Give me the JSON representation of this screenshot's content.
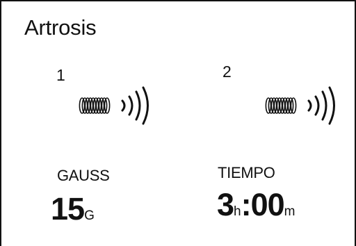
{
  "screen": {
    "title": "Artrosis"
  },
  "channels": [
    {
      "number": "1",
      "icon": "magnetic-coil-icon"
    },
    {
      "number": "2",
      "icon": "magnetic-coil-icon"
    }
  ],
  "gauss": {
    "label": "GAUSS",
    "value": "15",
    "unit": "G"
  },
  "tiempo": {
    "label": "TIEMPO",
    "hours": "3",
    "hours_unit": "h",
    "minutes": ":00",
    "minutes_unit": "m"
  },
  "colors": {
    "foreground": "#111111",
    "background": "#ffffff"
  }
}
